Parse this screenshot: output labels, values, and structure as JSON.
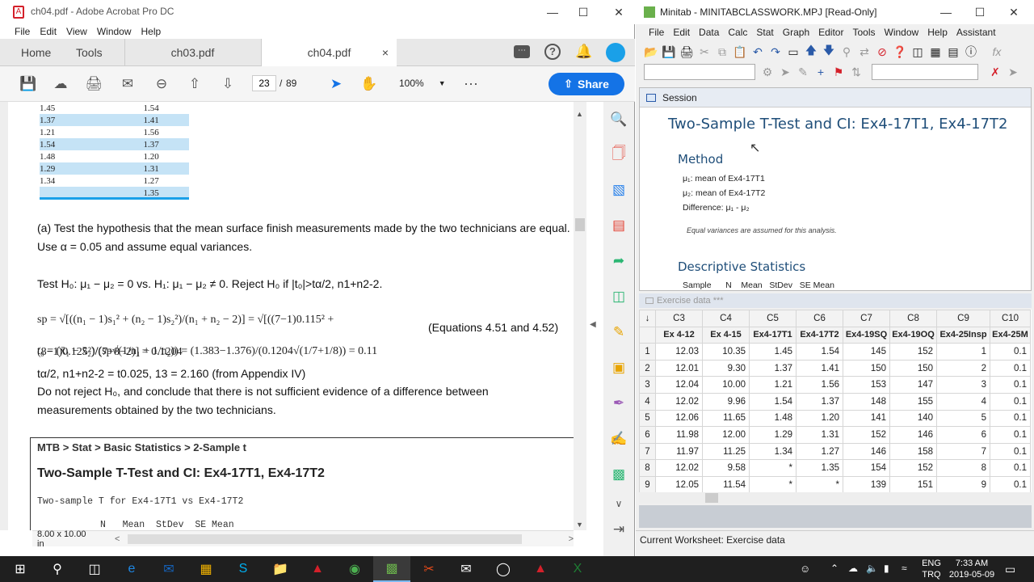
{
  "acrobat": {
    "title": "ch04.pdf - Adobe Acrobat Pro DC",
    "menu": [
      "File",
      "Edit",
      "View",
      "Window",
      "Help"
    ],
    "tabs": {
      "home": "Home",
      "tools": "Tools",
      "t1": "ch03.pdf",
      "t2": "ch04.pdf",
      "close": "×"
    },
    "page_current": "23",
    "page_sep": "/",
    "page_total": "89",
    "zoom": "100%",
    "share": "Share",
    "page_size": "8.00 x 10.00 in"
  },
  "doc": {
    "table_rows": [
      [
        "1.45",
        "1.54"
      ],
      [
        "1.37",
        "1.41"
      ],
      [
        "1.21",
        "1.56"
      ],
      [
        "1.54",
        "1.37"
      ],
      [
        "1.48",
        "1.20"
      ],
      [
        "1.29",
        "1.31"
      ],
      [
        "1.34",
        "1.27"
      ],
      [
        "",
        "1.35"
      ]
    ],
    "part_a": "(a) Test the hypothesis that the mean surface finish measurements made by the two technicians are equal. Use α = 0.05 and assume equal variances.",
    "test_line": "Test H₀: μ₁ − μ₂ = 0 vs. H₁: μ₁ − μ₂ ≠ 0.  Reject H₀ if |t₀|>tα/2, n1+n2-2.",
    "sp_formula": "sp = √[((n₁ − 1)s₁² + (n₂ − 1)s₂²)/(n₁ + n₂ − 2)] = √[((7−1)0.115² + (8−1)0.125²)/(7+8−2)] = 0.1204",
    "eq_ref": "(Equations 4.51 and 4.52)",
    "t0_formula": "t₀ = (x̄₁ − x̄₂)/(sp√(1/n₁ + 1/n₂)) = (1.383−1.376)/(0.1204√(1/7+1/8)) = 0.11",
    "crit": "tα/2, n1+n2-2 = t0.025, 13 = 2.160 (from Appendix IV)",
    "conclusion": "Do not reject H₀, and conclude that there is not sufficient evidence of a difference between measurements obtained by the two technicians.",
    "mtb_path": "MTB > Stat > Basic Statistics > 2-Sample t",
    "mtb_title": "Two-Sample T-Test and CI: Ex4-17T1, Ex4-17T2",
    "mtb_line1": "Two-sample T for Ex4-17T1 vs Ex4-17T2",
    "mtb_header": "N   Mean  StDev  SE Mean"
  },
  "minitab": {
    "title": "Minitab - MINITABCLASSWORK.MPJ  [Read-Only]",
    "menu": [
      "File",
      "Edit",
      "Data",
      "Calc",
      "Stat",
      "Graph",
      "Editor",
      "Tools",
      "Window",
      "Help",
      "Assistant"
    ],
    "session_label": "Session",
    "session_title": "Two-Sample T-Test and CI: Ex4-17T1, Ex4-17T2",
    "method_head": "Method",
    "m1": "μ₁: mean of Ex4-17T1",
    "m2": "μ₂: mean of Ex4-17T2",
    "m3": "Difference: μ₁ - μ₂",
    "note": "Equal variances are assumed for this analysis.",
    "desc_head": "Descriptive Statistics",
    "desc_cols": "Sample      N    Mean   StDev   SE Mean",
    "worksheet_title": "Exercise data ***",
    "col_ids": [
      "C3",
      "C4",
      "C5",
      "C6",
      "C7",
      "C8",
      "C9",
      "C10"
    ],
    "col_names": [
      "Ex 4-12",
      "Ex 4-15",
      "Ex4-17T1",
      "Ex4-17T2",
      "Ex4-19SQ",
      "Ex4-19OQ",
      "Ex4-25Insp",
      "Ex4-25M"
    ],
    "rows": [
      [
        "1",
        "12.03",
        "10.35",
        "1.45",
        "1.54",
        "145",
        "152",
        "1",
        "0.1"
      ],
      [
        "2",
        "12.01",
        "9.30",
        "1.37",
        "1.41",
        "150",
        "150",
        "2",
        "0.1"
      ],
      [
        "3",
        "12.04",
        "10.00",
        "1.21",
        "1.56",
        "153",
        "147",
        "3",
        "0.1"
      ],
      [
        "4",
        "12.02",
        "9.96",
        "1.54",
        "1.37",
        "148",
        "155",
        "4",
        "0.1"
      ],
      [
        "5",
        "12.06",
        "11.65",
        "1.48",
        "1.20",
        "141",
        "140",
        "5",
        "0.1"
      ],
      [
        "6",
        "11.98",
        "12.00",
        "1.29",
        "1.31",
        "152",
        "146",
        "6",
        "0.1"
      ],
      [
        "7",
        "11.97",
        "11.25",
        "1.34",
        "1.27",
        "146",
        "158",
        "7",
        "0.1"
      ],
      [
        "8",
        "12.02",
        "9.58",
        "*",
        "1.35",
        "154",
        "152",
        "8",
        "0.1"
      ],
      [
        "9",
        "12.05",
        "11.54",
        "*",
        "*",
        "139",
        "151",
        "9",
        "0.1"
      ]
    ],
    "status": "Current Worksheet: Exercise data"
  },
  "taskbar": {
    "lang1": "ENG",
    "lang2": "TRQ",
    "time": "7:33 AM",
    "date": "2019-05-09"
  },
  "colors": {
    "acrobat_red": "#d4202a",
    "share_blue": "#1473e6",
    "minitab_heading": "#1f4e79",
    "table_highlight": "#c5e3f6",
    "table_rule": "#1aa0e8"
  }
}
